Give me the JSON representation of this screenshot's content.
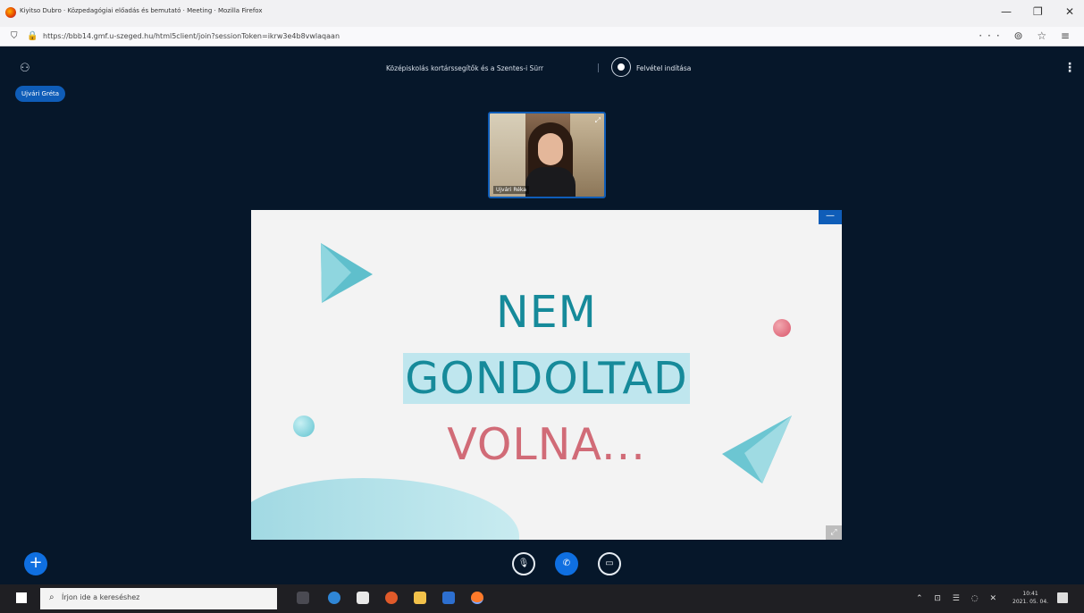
{
  "browser": {
    "tab_title": "Kiyitso Dubro · Közpedagógiai előadás és bemutató · Meeting · Mozilla Firefox",
    "url": "https://bbb14.gmf.u-szeged.hu/html5client/join?sessionToken=ikrw3e4b8vwlaqaan",
    "window_controls": [
      "—",
      "❐",
      "✕"
    ],
    "toolbar_icons": "··· ⊚ ☆ ≡"
  },
  "meeting": {
    "users_icon": "users-icon",
    "presenter_pill": "Ujvári Gréta",
    "title": "Középiskolás kortárssegítők és a Szentes-i Sürr",
    "recording_label": "Felvétel indítása",
    "kebab": "⋮"
  },
  "webcam": {
    "name": "Ujvári Réka"
  },
  "slide": {
    "line1": "NEM",
    "line2": "GONDOLTAD",
    "line3": "VOLNA...",
    "minimize_label": "—",
    "fit_label": "⤢"
  },
  "controls": {
    "fab_label": "+",
    "mute_label": "🎙",
    "hangup_label": "✆",
    "share_label": "▭"
  },
  "taskbar": {
    "search_placeholder": "Írjon ide a kereséshez",
    "tray": "⌃ ⊡ ☰ ◌ ✕",
    "clock_time": "10:41",
    "clock_date": "2021. 05. 04."
  },
  "colors": {
    "accent": "#0f5db8",
    "teal_text": "#168a9a",
    "pink_text": "#d16b77",
    "background": "#06172a"
  }
}
